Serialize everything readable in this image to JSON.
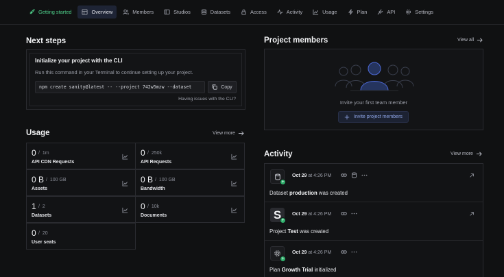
{
  "nav": {
    "items": [
      {
        "label": "Getting started",
        "icon": "rocket-icon"
      },
      {
        "label": "Overview",
        "icon": "dashboard-icon"
      },
      {
        "label": "Members",
        "icon": "users-icon"
      },
      {
        "label": "Studios",
        "icon": "studio-icon"
      },
      {
        "label": "Datasets",
        "icon": "database-icon"
      },
      {
        "label": "Access",
        "icon": "lock-icon"
      },
      {
        "label": "Activity",
        "icon": "activity-icon"
      },
      {
        "label": "Usage",
        "icon": "chart-icon"
      },
      {
        "label": "Plan",
        "icon": "bolt-icon"
      },
      {
        "label": "API",
        "icon": "plug-icon"
      },
      {
        "label": "Settings",
        "icon": "gear-icon"
      }
    ],
    "active": "Overview"
  },
  "next_steps": {
    "title": "Next steps",
    "cli_title": "Initialize your project with the CLI",
    "cli_desc": "Run this command in your Terminal to continue setting up your project.",
    "command": "npm create sanity@latest -- --project 742w5mzw --dataset",
    "copy_label": "Copy",
    "help_link": "Having issues with the CLI?"
  },
  "usage": {
    "title": "Usage",
    "view_more": "View more",
    "cells": [
      {
        "value": "0",
        "limit": "1m",
        "label": "API CDN Requests"
      },
      {
        "value": "0",
        "limit": "250k",
        "label": "API Requests"
      },
      {
        "value": "0 B",
        "limit": "100 GB",
        "label": "Assets"
      },
      {
        "value": "0 B",
        "limit": "100 GB",
        "label": "Bandwidth"
      },
      {
        "value": "1",
        "limit": "2",
        "label": "Datasets"
      },
      {
        "value": "0",
        "limit": "10k",
        "label": "Documents"
      },
      {
        "value": "0",
        "limit": "20",
        "label": "User seats"
      }
    ]
  },
  "members": {
    "title": "Project members",
    "view_all": "View all",
    "invite_text": "Invite your first team member",
    "invite_button": "Invite project members"
  },
  "activity": {
    "title": "Activity",
    "view_more": "View more",
    "items": [
      {
        "date": "Oct 29",
        "time_prefix": "at",
        "time": "4:26 PM",
        "text_pre": "Dataset ",
        "text_bold": "production",
        "text_post": " was created",
        "avatar": "database-icon"
      },
      {
        "date": "Oct 29",
        "time_prefix": "at",
        "time": "4:26 PM",
        "text_pre": "Project ",
        "text_bold": "Test",
        "text_post": " was created",
        "avatar": "S"
      },
      {
        "date": "Oct 29",
        "time_prefix": "at",
        "time": "4:26 PM",
        "text_pre": "Plan ",
        "text_bold": "Growth Trial",
        "text_post": " initialized",
        "avatar": "gear-icon"
      }
    ]
  },
  "colors": {
    "accent_green": "#4fd18b",
    "active_bg": "#1e2435",
    "link_blue": "#8fa6e8"
  }
}
